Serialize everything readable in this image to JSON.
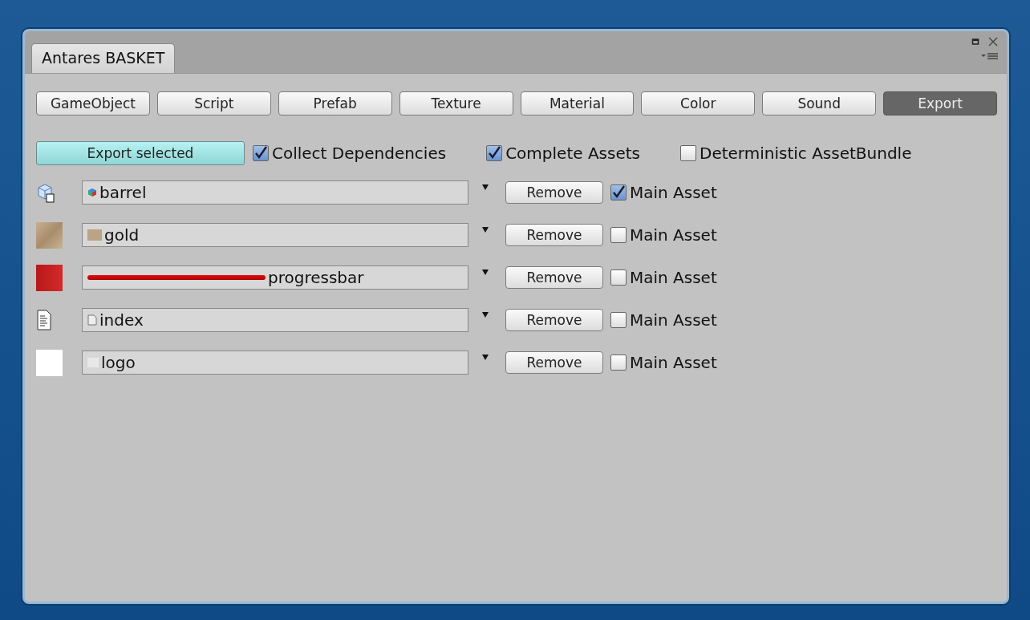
{
  "window": {
    "tab_title": "Antares BASKET"
  },
  "toolbar": [
    {
      "label": "GameObject",
      "selected": false
    },
    {
      "label": "Script",
      "selected": false
    },
    {
      "label": "Prefab",
      "selected": false
    },
    {
      "label": "Texture",
      "selected": false
    },
    {
      "label": "Material",
      "selected": false
    },
    {
      "label": "Color",
      "selected": false
    },
    {
      "label": "Sound",
      "selected": false
    },
    {
      "label": "Export",
      "selected": true
    }
  ],
  "export_button": "Export selected",
  "options": [
    {
      "label": "Collect Dependencies",
      "checked": true
    },
    {
      "label": "Complete Assets",
      "checked": true
    },
    {
      "label": "Deterministic AssetBundle",
      "checked": false
    }
  ],
  "assets": [
    {
      "kind": "model",
      "name": "barrel",
      "remove": "Remove",
      "main_label": "Main Asset",
      "main_asset": true
    },
    {
      "kind": "texture",
      "name": "gold",
      "remove": "Remove",
      "main_label": "Main Asset",
      "main_asset": false
    },
    {
      "kind": "bar",
      "name": "progressbar",
      "remove": "Remove",
      "main_label": "Main Asset",
      "main_asset": false
    },
    {
      "kind": "text",
      "name": "index",
      "remove": "Remove",
      "main_label": "Main Asset",
      "main_asset": false
    },
    {
      "kind": "blank",
      "name": "logo",
      "remove": "Remove",
      "main_label": "Main Asset",
      "main_asset": false
    }
  ]
}
